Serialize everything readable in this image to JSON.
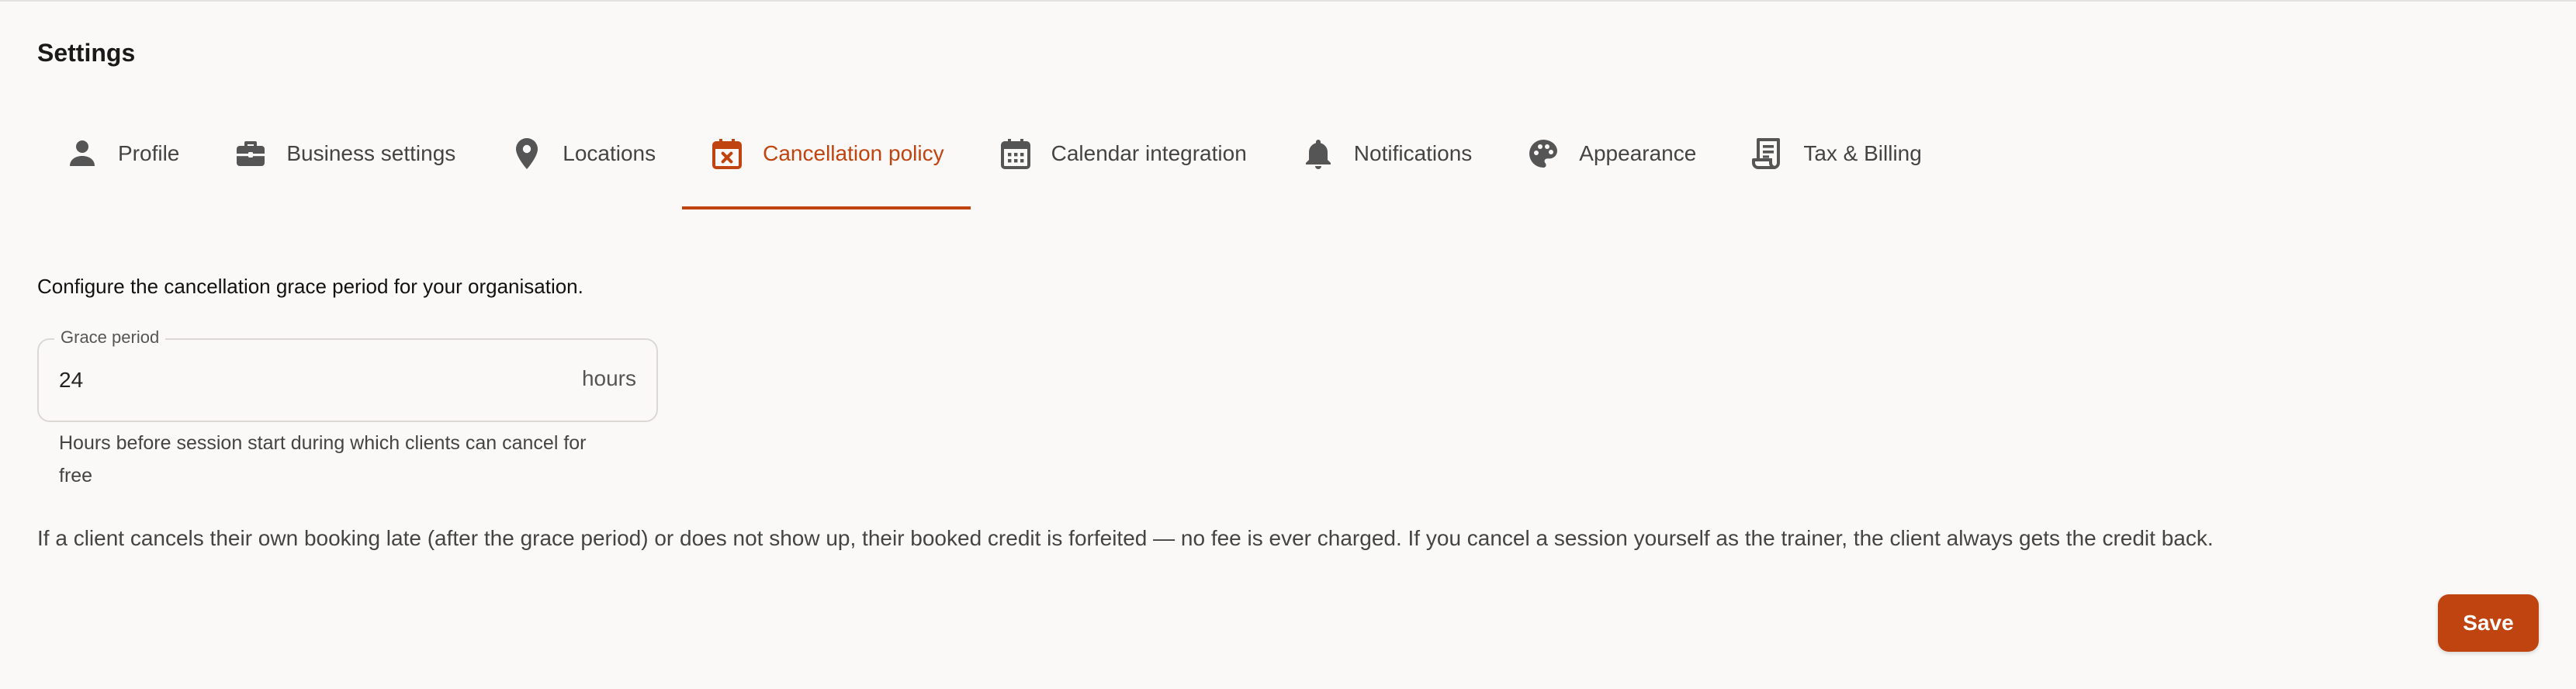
{
  "page": {
    "title": "Settings"
  },
  "colors": {
    "accent": "#c0440f",
    "text": "#1f1f1f",
    "muted": "#444444",
    "background": "#faf9f8"
  },
  "tabs": [
    {
      "label": "Profile",
      "icon": "person-icon",
      "active": false
    },
    {
      "label": "Business settings",
      "icon": "briefcase-icon",
      "active": false
    },
    {
      "label": "Locations",
      "icon": "location-pin-icon",
      "active": false
    },
    {
      "label": "Cancellation policy",
      "icon": "calendar-cancel-icon",
      "active": true
    },
    {
      "label": "Calendar integration",
      "icon": "calendar-icon",
      "active": false
    },
    {
      "label": "Notifications",
      "icon": "bell-icon",
      "active": false
    },
    {
      "label": "Appearance",
      "icon": "palette-icon",
      "active": false
    },
    {
      "label": "Tax & Billing",
      "icon": "receipt-icon",
      "active": false
    }
  ],
  "cancellation": {
    "intro": "Configure the cancellation grace period for your organisation.",
    "grace_period": {
      "label": "Grace period",
      "value": "24",
      "suffix": "hours",
      "helper": "Hours before session start during which clients can cancel for free"
    },
    "policy_note": "If a client cancels their own booking late (after the grace period) or does not show up, their booked credit is forfeited — no fee is ever charged. If you cancel a session yourself as the trainer, the client always gets the credit back.",
    "save_label": "Save"
  }
}
